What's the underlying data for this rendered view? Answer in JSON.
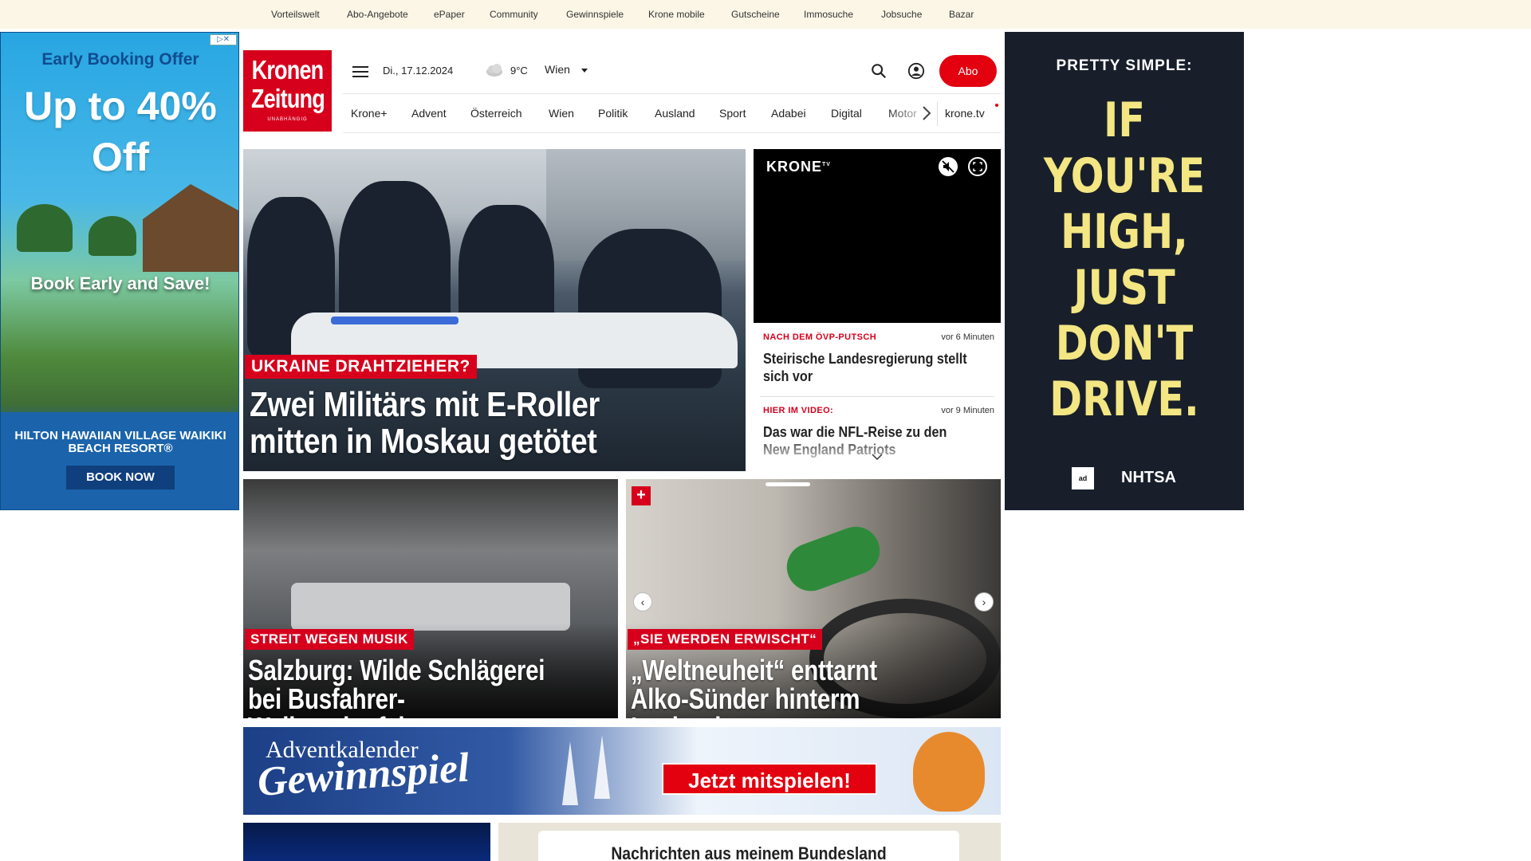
{
  "topbar": {
    "links": [
      "Vorteilswelt",
      "Abo-Angebote",
      "ePaper",
      "Community",
      "Gewinnspiele",
      "Krone mobile",
      "Gutscheine",
      "Immosuche",
      "Jobsuche",
      "Bazar"
    ]
  },
  "ad_left": {
    "headline": "Early Booking Offer",
    "offer": "Up to 40% Off",
    "tagline": "Book Early and Save!",
    "brand": "HILTON HAWAIIAN VILLAGE WAIKIKI BEACH RESORT®",
    "cta": "BOOK NOW"
  },
  "ad_right": {
    "kicker": "PRETTY SIMPLE:",
    "message": "IF YOU'RE HIGH, JUST DON'T DRIVE.",
    "logo1": "ad",
    "logo2": "NHTSA"
  },
  "header": {
    "logo_line1": "Kronen",
    "logo_line2": "Zeitung",
    "logo_line3": "UNABHÄNGIG",
    "date": "Di., 17.12.2024",
    "temperature": "9°C",
    "city": "Wien",
    "abo_label": "Abo"
  },
  "nav": {
    "items": [
      "Krone+",
      "Advent",
      "Österreich",
      "Wien",
      "Politik",
      "Ausland",
      "Sport",
      "Adabei",
      "Digital",
      "Motor"
    ],
    "tv_link": "krone.tv"
  },
  "hero": {
    "kicker": "UKRAINE DRAHTZIEHER?",
    "headline": "Zwei Militärs mit E-Roller mitten in Moskau getötet"
  },
  "video": {
    "brand": "KRONE",
    "brand_sup": "TV"
  },
  "ticker": [
    {
      "kicker": "NACH DEM ÖVP-PUTSCH",
      "time": "vor 6 Minuten",
      "title": "Steirische Landesregierung stellt sich vor"
    },
    {
      "kicker": "HIER IM VIDEO:",
      "time": "vor 9 Minuten",
      "title": "Das war die NFL-Reise zu den New England Patriots"
    }
  ],
  "tiles": [
    {
      "kicker": "STREIT WEGEN MUSIK",
      "headline": "Salzburg: Wilde Schlägerei bei Busfahrer-Weihnachtsfeier"
    },
    {
      "kicker": "„SIE WERDEN ERWISCHT“",
      "headline": "„Weltneuheit“ enttarnt Alko-Sünder hinterm Lenkrad",
      "plus": "+"
    }
  ],
  "advent": {
    "line1": "Adventkalender",
    "line2": "Gewinnspiel",
    "cta": "Jetzt mitspielen!"
  },
  "bundesland": {
    "title": "Nachrichten aus meinem Bundesland"
  }
}
